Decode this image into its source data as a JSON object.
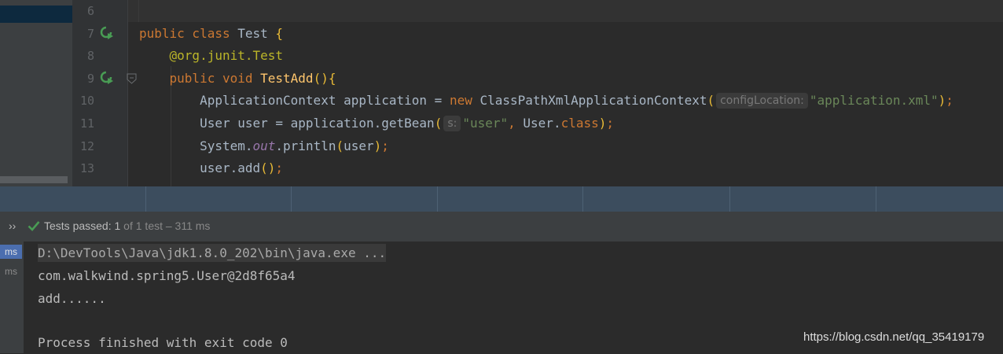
{
  "editor": {
    "lines": [
      {
        "num": "6"
      },
      {
        "num": "7",
        "tokens": [
          [
            "kw",
            "public class "
          ],
          [
            "p",
            "Test "
          ],
          [
            "pb",
            "{"
          ]
        ]
      },
      {
        "num": "8",
        "tokens": [
          [
            "p",
            "    "
          ],
          [
            "ann",
            "@org.junit.Test"
          ]
        ]
      },
      {
        "num": "9",
        "tokens": [
          [
            "p",
            "    "
          ],
          [
            "kw",
            "public void "
          ],
          [
            "fn",
            "TestAdd"
          ],
          [
            "pb",
            "(){"
          ]
        ]
      },
      {
        "num": "10",
        "tokens": [
          [
            "p",
            "        ApplicationContext application = "
          ],
          [
            "kw",
            "new "
          ],
          [
            "p",
            "ClassPathXmlApplicationContext"
          ],
          [
            "pb",
            "("
          ],
          [
            "hint",
            "configLocation:"
          ],
          [
            "str",
            "\"application.xml\""
          ],
          [
            "pb",
            ")"
          ],
          [
            "kw",
            ";"
          ]
        ]
      },
      {
        "num": "11",
        "tokens": [
          [
            "p",
            "        User user = application.getBean"
          ],
          [
            "pb",
            "("
          ],
          [
            "hint",
            "s:"
          ],
          [
            "str",
            "\"user\""
          ],
          [
            "kw",
            ", "
          ],
          [
            "p",
            "User."
          ],
          [
            "kw",
            "class"
          ],
          [
            "pb",
            ")"
          ],
          [
            "kw",
            ";"
          ]
        ]
      },
      {
        "num": "12",
        "tokens": [
          [
            "p",
            "        System."
          ],
          [
            "st",
            "out"
          ],
          [
            "p",
            ".println"
          ],
          [
            "pb",
            "("
          ],
          [
            "p",
            "user"
          ],
          [
            "pb",
            ")"
          ],
          [
            "kw",
            ";"
          ]
        ]
      },
      {
        "num": "13",
        "tokens": [
          [
            "p",
            "        user.add"
          ],
          [
            "pb",
            "()"
          ],
          [
            "kw",
            ";"
          ]
        ]
      }
    ],
    "run_icon_lines": [
      "7",
      "9"
    ]
  },
  "run": {
    "chevron": "››",
    "status_label": "Tests passed: ",
    "passed_count": "1",
    "status_detail": " of 1 test – 311 ms"
  },
  "tests_tree": [
    "ms",
    "ms"
  ],
  "console": {
    "command": "D:\\DevTools\\Java\\jdk1.8.0_202\\bin\\java.exe ...",
    "lines": [
      "com.walkwind.spring5.User@2d8f65a4",
      "add......",
      "",
      "Process finished with exit code 0"
    ]
  },
  "watermark": "https://blog.csdn.net/qq_35419179"
}
